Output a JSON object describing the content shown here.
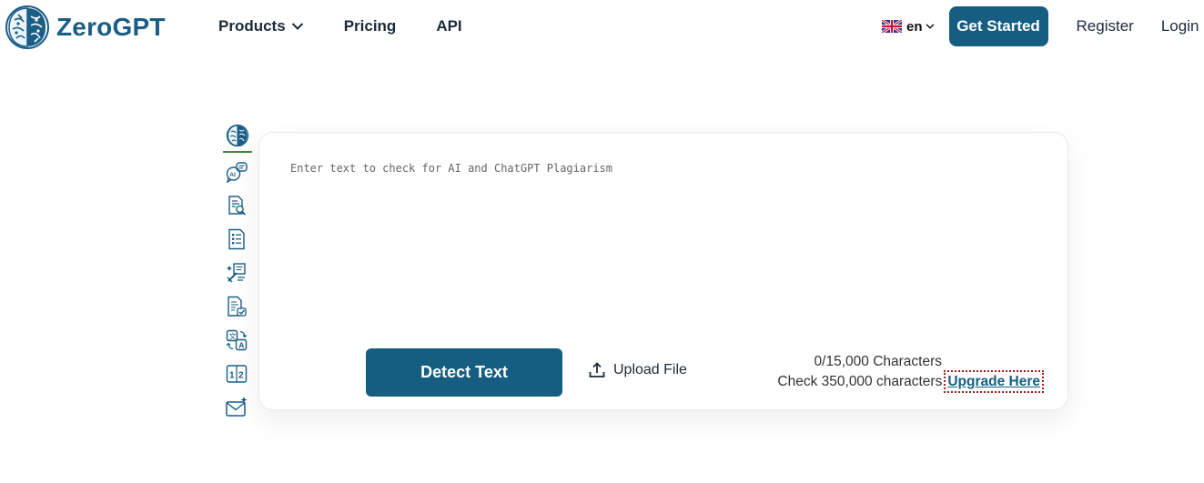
{
  "header": {
    "brand": "ZeroGPT",
    "nav": [
      {
        "label": "Products",
        "has_dropdown": true
      },
      {
        "label": "Pricing"
      },
      {
        "label": "API"
      }
    ],
    "language": {
      "code": "en",
      "flag": "uk-flag-icon"
    },
    "get_started": "Get Started",
    "register": "Register",
    "login": "Login"
  },
  "sidebar": {
    "tools": [
      {
        "icon": "brain-icon",
        "active": true
      },
      {
        "icon": "ai-chat-icon"
      },
      {
        "icon": "document-search-icon"
      },
      {
        "icon": "summary-list-icon"
      },
      {
        "icon": "paraphrase-tool-icon"
      },
      {
        "icon": "document-check-icon"
      },
      {
        "icon": "translate-icon"
      },
      {
        "icon": "word-counter-icon"
      },
      {
        "icon": "email-sparkle-icon"
      }
    ]
  },
  "editor": {
    "placeholder": "Enter text to check for AI and ChatGPT Plagiarism",
    "detect_label": "Detect Text",
    "upload_label": "Upload File",
    "char_count": "0/15,000 Characters",
    "upgrade_prompt": "Check 350,000 characters",
    "upgrade_link": "Upgrade Here"
  },
  "colors": {
    "brand": "#165d82",
    "text": "#1b2b3a",
    "active_indicator": "#3a8d3a"
  }
}
